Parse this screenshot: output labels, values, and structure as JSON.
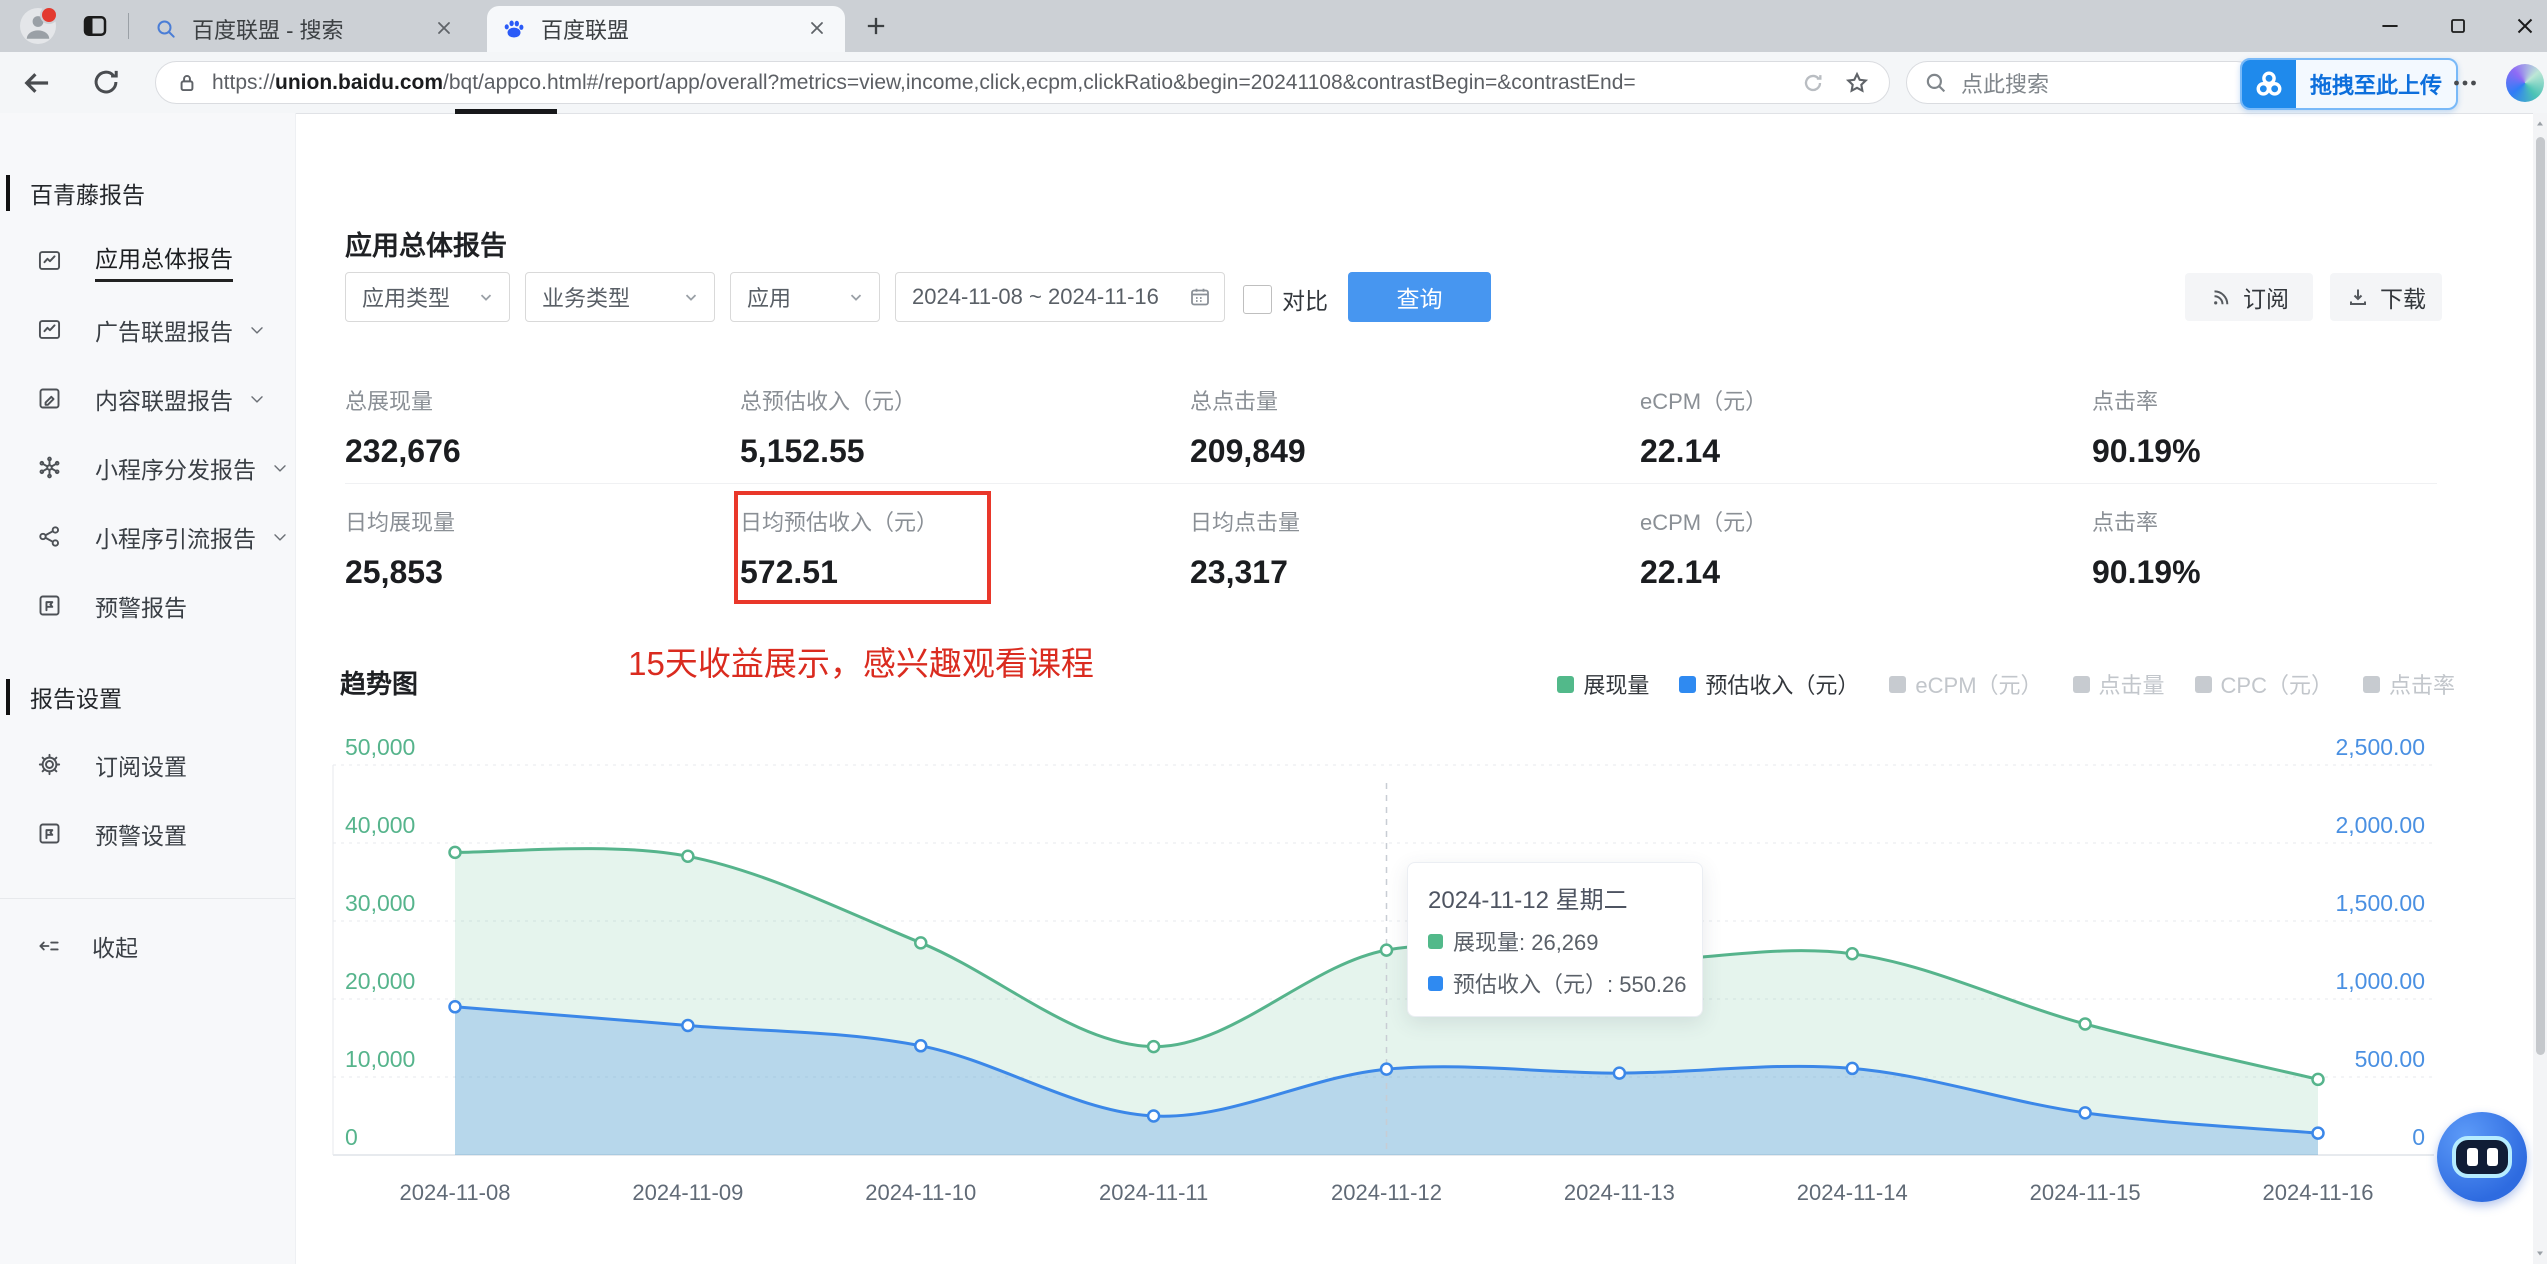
{
  "browser": {
    "tabs": [
      {
        "title": "百度联盟 - 搜索",
        "icon": "search-icon",
        "active": false
      },
      {
        "title": "百度联盟",
        "icon": "baidu-paw-icon",
        "active": true
      }
    ],
    "url_protocol": "https://",
    "url_host": "union.baidu.com",
    "url_path": "/bqt/appco.html#/report/app/overall?metrics=view,income,click,ecpm,clickRatio&begin=20241108&contrastBegin=&contrastEnd=",
    "search_placeholder": "点此搜索",
    "upload_badge_label": "拖拽至此上传"
  },
  "sidebar": {
    "sections": [
      {
        "header": "百青藤报告",
        "items": [
          {
            "label": "应用总体报告",
            "icon": "report-icon",
            "active": true,
            "chevron": false
          },
          {
            "label": "广告联盟报告",
            "icon": "report-icon",
            "active": false,
            "chevron": true
          },
          {
            "label": "内容联盟报告",
            "icon": "content-report-icon",
            "active": false,
            "chevron": true
          },
          {
            "label": "小程序分发报告",
            "icon": "mini-program-dispatch-icon",
            "active": false,
            "chevron": true
          },
          {
            "label": "小程序引流报告",
            "icon": "share-icon",
            "active": false,
            "chevron": true
          },
          {
            "label": "预警报告",
            "icon": "alert-report-icon",
            "active": false,
            "chevron": false
          }
        ]
      },
      {
        "header": "报告设置",
        "items": [
          {
            "label": "订阅设置",
            "icon": "gear-icon",
            "active": false,
            "chevron": false
          },
          {
            "label": "预警设置",
            "icon": "alert-report-icon",
            "active": false,
            "chevron": false
          }
        ]
      }
    ],
    "collapse_label": "收起"
  },
  "page": {
    "title": "应用总体报告",
    "filters": {
      "app_type": "应用类型",
      "biz_type": "业务类型",
      "app": "应用",
      "date_range": "2024-11-08 ~ 2024-11-16",
      "compare_label": "对比",
      "query_label": "查询"
    },
    "actions": {
      "subscribe": "订阅",
      "download": "下载"
    },
    "stats_row1": [
      {
        "label": "总展现量",
        "value": "232,676"
      },
      {
        "label": "总预估收入（元）",
        "value": "5,152.55"
      },
      {
        "label": "总点击量",
        "value": "209,849"
      },
      {
        "label": "eCPM（元）",
        "value": "22.14"
      },
      {
        "label": "点击率",
        "value": "90.19%"
      }
    ],
    "stats_row2": [
      {
        "label": "日均展现量",
        "value": "25,853"
      },
      {
        "label": "日均预估收入（元）",
        "value": "572.51",
        "highlighted": true
      },
      {
        "label": "日均点击量",
        "value": "23,317"
      },
      {
        "label": "eCPM（元）",
        "value": "22.14"
      },
      {
        "label": "点击率",
        "value": "90.19%"
      }
    ],
    "annotation": "15天收益展示，感兴趣观看课程",
    "chart_title": "趋势图"
  },
  "chart_data": {
    "type": "area",
    "x": [
      "2024-11-08",
      "2024-11-09",
      "2024-11-10",
      "2024-11-11",
      "2024-11-12",
      "2024-11-13",
      "2024-11-14",
      "2024-11-15",
      "2024-11-16"
    ],
    "series": [
      {
        "name": "展现量",
        "axis": "left",
        "color": "#56b48c",
        "fill": "rgba(92,185,140,0.16)",
        "values": [
          38800,
          38300,
          27200,
          13900,
          26269,
          24800,
          25800,
          16800,
          9700
        ]
      },
      {
        "name": "预估收入（元）",
        "axis": "right",
        "color": "#3b87e8",
        "fill": "rgba(77,148,233,0.30)",
        "values": [
          950,
          830,
          700,
          250,
          550.26,
          525,
          555,
          270,
          140
        ]
      }
    ],
    "left_axis": {
      "color": "#56b48c",
      "max": 50000,
      "ticks": [
        "0",
        "10,000",
        "20,000",
        "30,000",
        "40,000",
        "50,000"
      ]
    },
    "right_axis": {
      "color": "#4a90e2",
      "max": 2500,
      "ticks": [
        "0",
        "500.00",
        "1,000.00",
        "1,500.00",
        "2,000.00",
        "2,500.00"
      ]
    },
    "legend": [
      {
        "label": "展现量",
        "color": "#52b98a",
        "active": true
      },
      {
        "label": "预估收入（元）",
        "color": "#2f8af1",
        "active": true
      },
      {
        "label": "eCPM（元）",
        "color": "#c7cbd0",
        "active": false
      },
      {
        "label": "点击量",
        "color": "#c7cbd0",
        "active": false
      },
      {
        "label": "CPC（元）",
        "color": "#c7cbd0",
        "active": false
      },
      {
        "label": "点击率",
        "color": "#c7cbd0",
        "active": false
      }
    ],
    "grid": true,
    "tooltip": {
      "title": "2024-11-12 星期二",
      "x_index": 4,
      "rows": [
        {
          "swatch": "#52b98a",
          "text": "展现量: 26,269"
        },
        {
          "swatch": "#2f8af1",
          "text": "预估收入（元）: 550.26"
        }
      ]
    }
  }
}
